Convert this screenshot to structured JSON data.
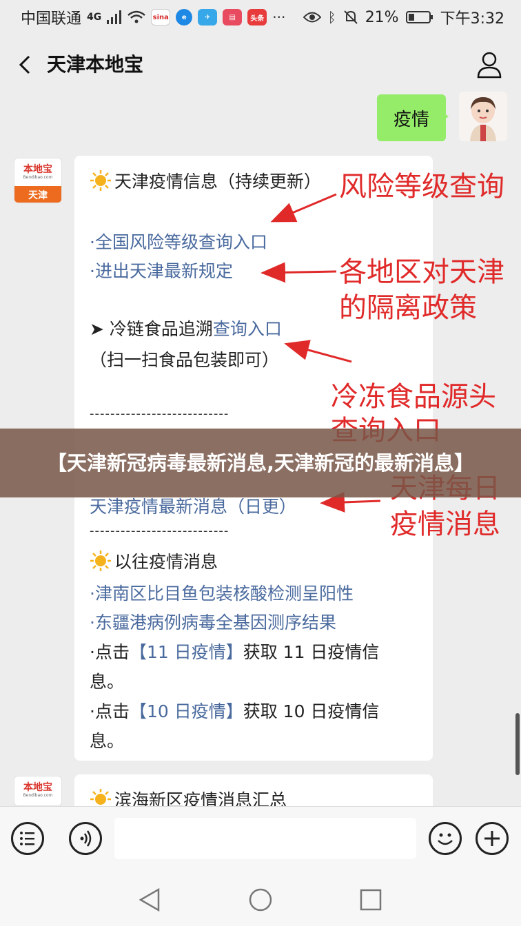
{
  "status_bar": {
    "carrier": "中国联通",
    "signal": "4G",
    "battery": "21%",
    "time": "下午3:32"
  },
  "nav": {
    "title": "天津本地宝",
    "back_icon": "chevron-left-icon",
    "profile_icon": "person-icon"
  },
  "chat": {
    "user_message": "疫情",
    "bot_avatar": {
      "brand": "本地宝",
      "site": "Bendibao.com",
      "city": "天津"
    },
    "card": {
      "heading_1": "天津疫情信息（持续更新）",
      "link_1": "·全国风险等级查询入口",
      "link_2": "·进出天津最新规定",
      "arrow_prefix": "➤ ",
      "cold_chain_text": "冷链食品追溯",
      "cold_chain_link": "查询入口",
      "cold_chain_note": "（扫一扫食品包装即可）",
      "divider": "---------------------------",
      "daily_link": "天津疫情最新消息（日更）",
      "heading_2": "以往疫情消息",
      "link_3": "·津南区比目鱼包装核酸检测呈阳性",
      "link_4": "·东疆港病例病毒全基因测序结果",
      "click_prefix": "·点击",
      "day11_link": "【11 日疫情】",
      "day11_suffix": "获取 11 日疫情信",
      "day11_end": "息。",
      "day10_link": "【10 日疫情】",
      "day10_suffix": "获取 10 日疫情信",
      "day10_end": "息。"
    },
    "card2": {
      "heading": "滨海新区疫情消息汇总"
    }
  },
  "annotations": {
    "a1": "风险等级查询",
    "a2_line1": "各地区对天津",
    "a2_line2": "的隔离政策",
    "a3_line1": "冷冻食品源头",
    "a3_line2": "查询入口",
    "a4_line1": "天津每日",
    "a4_line2": "疫情消息"
  },
  "overlay": {
    "title": "【天津新冠病毒最新消息,天津新冠的最新消息】"
  },
  "input_bar": {
    "menu_icon": "menu-list-icon",
    "voice_icon": "voice-icon",
    "emoji_icon": "emoji-icon",
    "plus_icon": "plus-icon",
    "placeholder": ""
  },
  "colors": {
    "bubble_green": "#95ec69",
    "link_blue": "#4a6a9e",
    "annotation_red": "#e02a2a",
    "overlay": "#785648"
  }
}
